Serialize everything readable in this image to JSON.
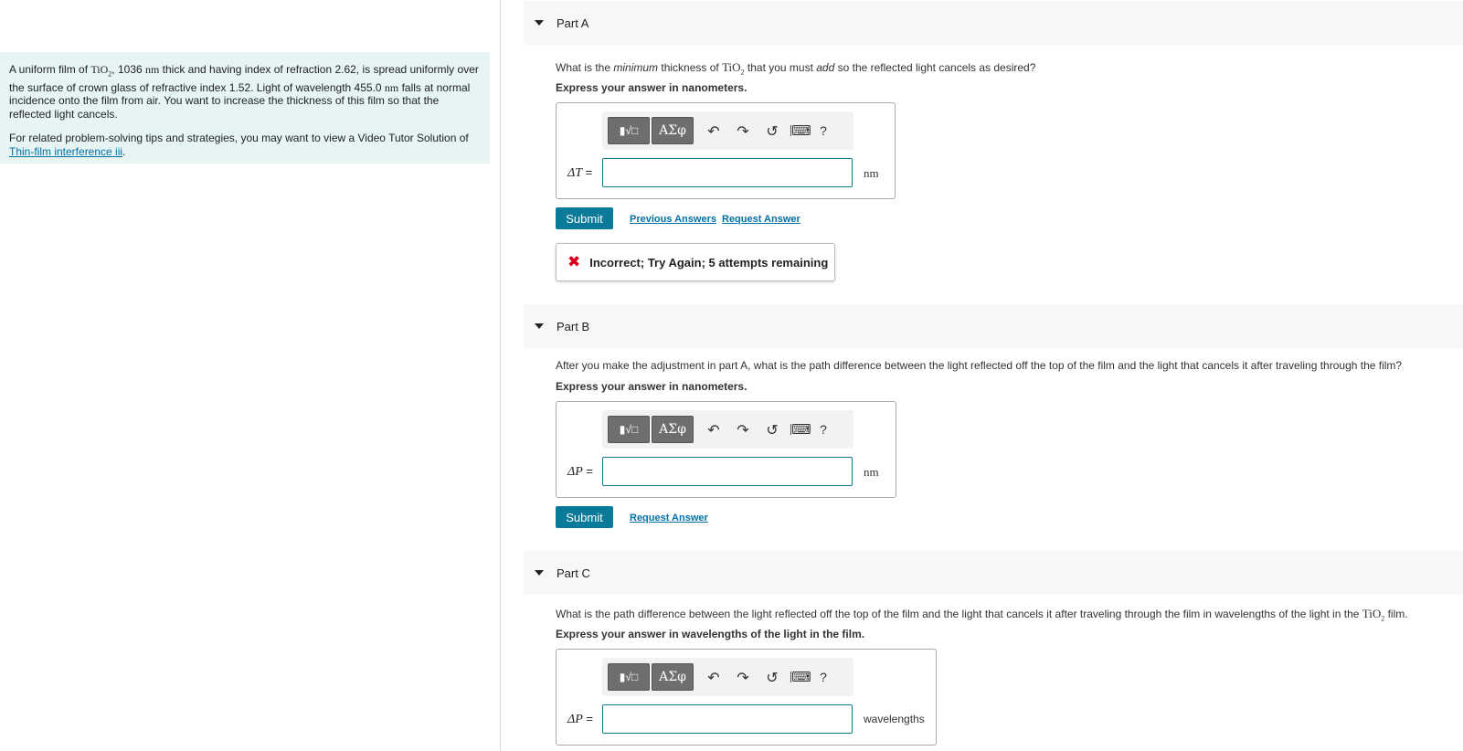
{
  "problem": {
    "intro_prefix": "A uniform film of ",
    "material": "TiO",
    "material_sub": "2",
    "intro_mid1": ", 1036 ",
    "unit_nm": "nm",
    "intro_mid2": " thick and having index of refraction 2.62, is spread uniformly over the surface of crown glass of refractive index 1.52. Light of wavelength 455.0 ",
    "intro_end": " falls at normal incidence onto the film from air. You want to increase the thickness of this film so that the reflected light cancels.",
    "tips_text": "For related problem-solving tips and strategies, you may want to view a Video Tutor Solution of ",
    "tips_link": "Thin-film interference iii",
    "tips_end": "."
  },
  "toolbar": {
    "template_symbol": "▮√□",
    "greek_label": "ΑΣφ",
    "undo_icon": "↶",
    "redo_icon": "↷",
    "reset_icon": "↺",
    "keyboard_icon": "⌨",
    "help_label": "?"
  },
  "parts": [
    {
      "title": "Part A",
      "question_prefix": "What is the ",
      "question_em1": "minimum",
      "question_mid": " thickness of ",
      "question_chem": "TiO",
      "question_chem_sub": "2",
      "question_mid2": " that you must ",
      "question_em2": "add",
      "question_end": " so the reflected light cancels as desired?",
      "express": "Express your answer in nanometers.",
      "var_label": "ΔT",
      "eq": " =",
      "input_value": "",
      "unit": "nm",
      "submit": "Submit",
      "previous_answers": "Previous Answers",
      "request_answer": "Request Answer",
      "feedback": "Incorrect; Try Again; 5 attempts remaining",
      "feedback_icon": "✖"
    },
    {
      "title": "Part B",
      "question": "After you make the adjustment in part A, what is the path difference between the light reflected off the top of the film and the light that cancels it after traveling through the film?",
      "express": "Express your answer in nanometers.",
      "var_label": "ΔP",
      "eq": " =",
      "input_value": "",
      "unit": "nm",
      "submit": "Submit",
      "request_answer": "Request Answer"
    },
    {
      "title": "Part C",
      "question_prefix": "What is the path difference between the light reflected off the top of the film and the light that cancels it after traveling through the film in wavelengths of the light in the ",
      "question_chem": "TiO",
      "question_chem_sub": "2",
      "question_end": " film.",
      "express": "Express your answer in wavelengths of the light in the film.",
      "var_label": "ΔP",
      "eq": " =",
      "input_value": "",
      "unit": "wavelengths"
    }
  ]
}
